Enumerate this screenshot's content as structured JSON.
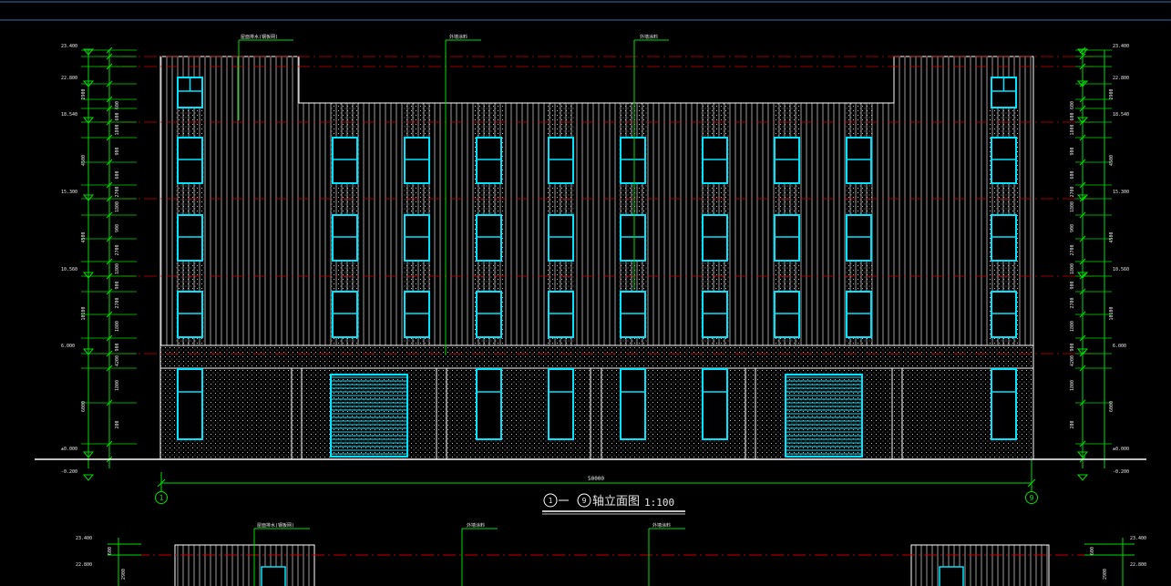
{
  "drawing": {
    "title_axis_start": "1",
    "title_axis_end": "9",
    "title_text": "轴立面图",
    "title_scale": "1:100",
    "overall_dimension": "50000",
    "axis_bubble_left": "1",
    "axis_bubble_right": "9",
    "leaders": {
      "left": "屋面排水(钢板网)",
      "center1": "外墙涂料",
      "center2": "外墙涂料",
      "bottom_left": "屋面排水(钢板网)",
      "bottom_center1": "外墙涂料",
      "bottom_center2": "外墙涂料"
    },
    "elevations_left": [
      "23.400",
      "22.800",
      "18.540",
      "15.300",
      "10.560",
      "6.000",
      "±0.000",
      "-0.200"
    ],
    "elevations_right": [
      "23.400",
      "22.800",
      "18.540",
      "15.300",
      "10.560",
      "6.000",
      "±0.000",
      "-0.200"
    ],
    "dims_left_inner": [
      "600",
      "600",
      "1800",
      "900",
      "600",
      "2700",
      "1800",
      "900",
      "2700",
      "1800",
      "900",
      "2700",
      "1800",
      "900",
      "4200",
      "1800",
      "200"
    ],
    "dims_left_outer": [
      "2900",
      "4500",
      "4500",
      "10100",
      "6000"
    ],
    "dims_right_inner": [
      "600",
      "600",
      "1800",
      "900",
      "600",
      "2700",
      "1800",
      "900",
      "2700",
      "1800",
      "900",
      "2700",
      "1800",
      "900",
      "4200",
      "1800",
      "200"
    ],
    "dims_right_outer": [
      "2900",
      "4500",
      "4500",
      "10100",
      "6000"
    ],
    "bottom_elevations_left": [
      "23.400",
      "22.800"
    ],
    "bottom_elevations_right": [
      "23.400",
      "22.800"
    ],
    "bottom_dims_left": [
      "600",
      "2900"
    ],
    "bottom_dims_right": [
      "600",
      "2900"
    ]
  },
  "colors": {
    "background": "#000000",
    "outline": "#ffffff",
    "window": "#00e5ff",
    "dimension": "#00dd00",
    "level_line": "#cc0000",
    "top_rule": "#2f6fb5",
    "text": "#e8e8e8"
  }
}
